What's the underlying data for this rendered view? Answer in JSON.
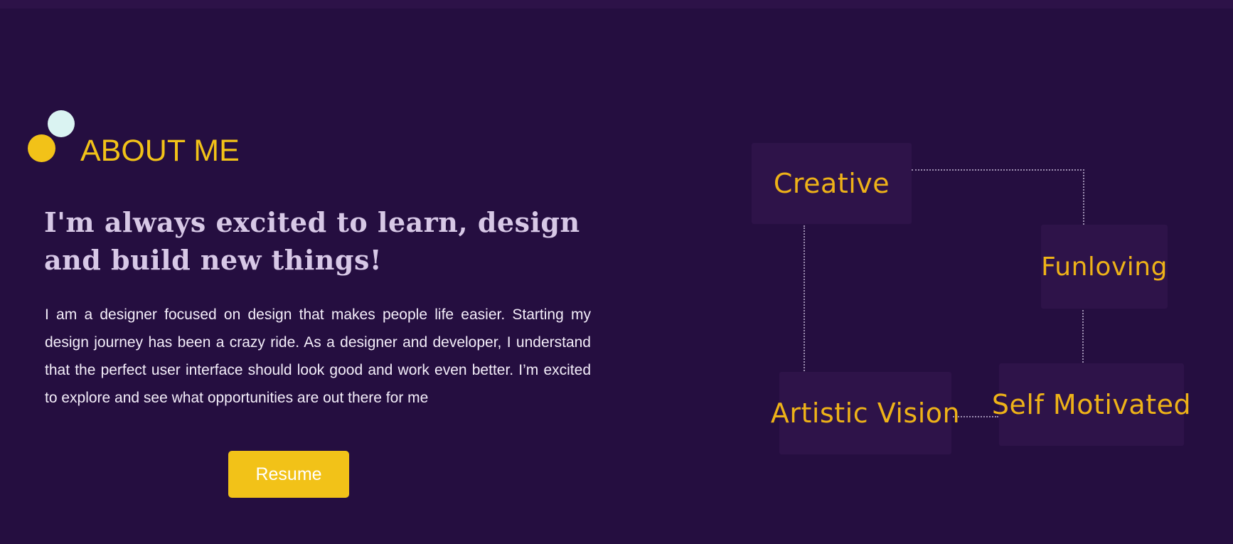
{
  "about": {
    "title": "ABOUT ME",
    "headline": "I'm always excited to learn, design and build new things!",
    "bio": "I am a designer focused on design that makes people life easier. Starting my design journey has been a crazy ride. As a designer and developer, I understand that the perfect user interface should look good and work even better. I’m excited to explore and see what opportunities are out there for me",
    "resume_label": "Resume"
  },
  "traits": [
    {
      "label": "Creative"
    },
    {
      "label": "Funloving"
    },
    {
      "label": "Artistic Vision"
    },
    {
      "label": "Self Motivated"
    }
  ],
  "colors": {
    "background": "#250e40",
    "accent": "#f2c218",
    "trait_text": "#eeb218",
    "trait_box": "#2e1349",
    "circle_mint": "#daf3f2",
    "headline": "#d7c8e6",
    "body_text": "#f4eefa"
  }
}
